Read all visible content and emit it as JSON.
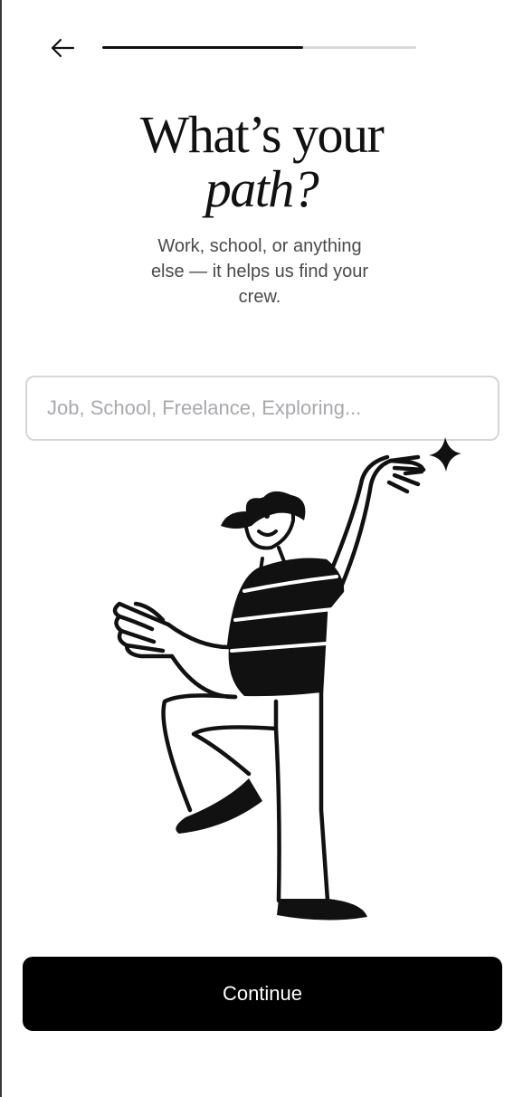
{
  "header": {
    "back_icon": "arrow-left-icon",
    "progress_fraction": 0.64
  },
  "title": {
    "line1": "What’s your",
    "line2": "path?"
  },
  "subtitle": "Work, school, or anything else — it helps us find your crew.",
  "path_input": {
    "value": "",
    "placeholder": "Job, School, Freelance, Exploring..."
  },
  "illustration": {
    "icon": "dancing-person-illustration",
    "sparkle_icon": "sparkle-icon"
  },
  "continue_label": "Continue",
  "colors": {
    "primary": "#000000",
    "on_primary": "#ffffff",
    "track": "#d9d9d9",
    "placeholder": "#a9a9ad",
    "subtitle": "#4a4a4a"
  }
}
